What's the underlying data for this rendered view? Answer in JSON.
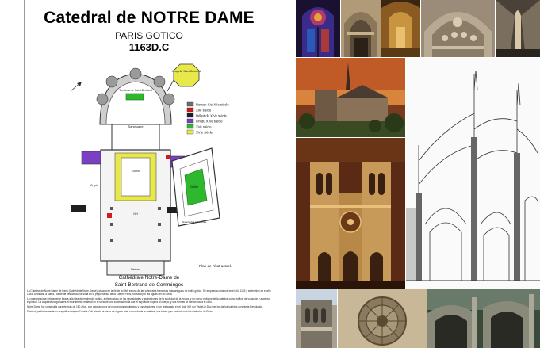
{
  "header": {
    "title": "Catedral de NOTRE DAME",
    "subtitle": "PARIS GOTICO",
    "date": "1163D.C"
  },
  "plan": {
    "caption_line1": "Cathédrale Notre-Dame de",
    "caption_line2": "Saint-Bertrand-de-Comminges",
    "state_note": "Plan de l'état actuel.",
    "chapel_label": "Chapelle Saint-Bertrand",
    "tomb_label": "Tombeau de Saint-Bertrand",
    "sanctuary_label": "Sanctuaire",
    "nave_label": "Nef",
    "choir_label": "Chœur",
    "cloister_label": "Cloître",
    "gallery_label": "Galerie des réfectoires",
    "crypt_label": "Crypte",
    "porch_label": "Narthex",
    "legend": [
      {
        "label": "Roman XIe-XIIe siècle",
        "color": "#6d6d6d"
      },
      {
        "label": "XIIe siècle",
        "color": "#d11a1a"
      },
      {
        "label": "Début du XIVe siècle",
        "color": "#1f1f1f"
      },
      {
        "label": "Fin du XIVe siècle",
        "color": "#7b3fc4"
      },
      {
        "label": "XVe siècle",
        "color": "#2eb82e"
      },
      {
        "label": "XVIe siècle",
        "color": "#e8e84a"
      }
    ]
  },
  "body_paragraphs": [
    "La Catedral de Notre Dame de París (Cathédrale Notre-Dame), situada en la île de la Cité, es una de las catedrales francesas más antiguas de estilo gótico. Se empezó a construir en el año 1163 y se terminó en el año 1345. Dedicada a María, Madre de Jesucristo, se sitúa en la pequeña isla de la Cité en París, rodeada por las aguas del río Sena.",
    "La catedral surge íntimamente ligada a la idea del esplendor gótico, a efecto claro de las necesidades y aspiraciones de la sociedad de la época, y un nuevo enfoque de la catedral como edificio de vocación y ascenso espiritual. La arquitectura gótica es el instrumento material en el seno de una sociedad en la que el espíritu le supera al cuerpo, y sus formas se elevan hacia el cielo.",
    "Notre Dame fue construida durante más de 180 años, con aportaciones de numerosos arquitectos y constructores, y fue restaurada en el siglo XIX por Viollet-le-Duc tras los daños sufridos durante la Revolución.",
    "Destaca particularmente su magnífica imagen Cavallé-Coll, siendo la pieza de órgano más conocida de la catedral; sus torres y su fachada son los símbolos de París."
  ],
  "photos": [
    {
      "id": "rose-window",
      "icon": "stained-glass-icon"
    },
    {
      "id": "portal",
      "icon": "portal-icon"
    },
    {
      "id": "interior-gold",
      "icon": "interior-icon"
    },
    {
      "id": "tympanum",
      "icon": "sculpture-icon"
    },
    {
      "id": "nave-interior",
      "icon": "nave-icon"
    },
    {
      "id": "exterior-day",
      "icon": "cathedral-icon"
    },
    {
      "id": "facade-night",
      "icon": "facade-icon"
    },
    {
      "id": "section-drawing",
      "icon": "drawing-icon"
    },
    {
      "id": "tower-detail",
      "icon": "tower-icon"
    },
    {
      "id": "rose-detail",
      "icon": "rose-icon"
    },
    {
      "id": "buttress-detail",
      "icon": "buttress-icon"
    }
  ]
}
